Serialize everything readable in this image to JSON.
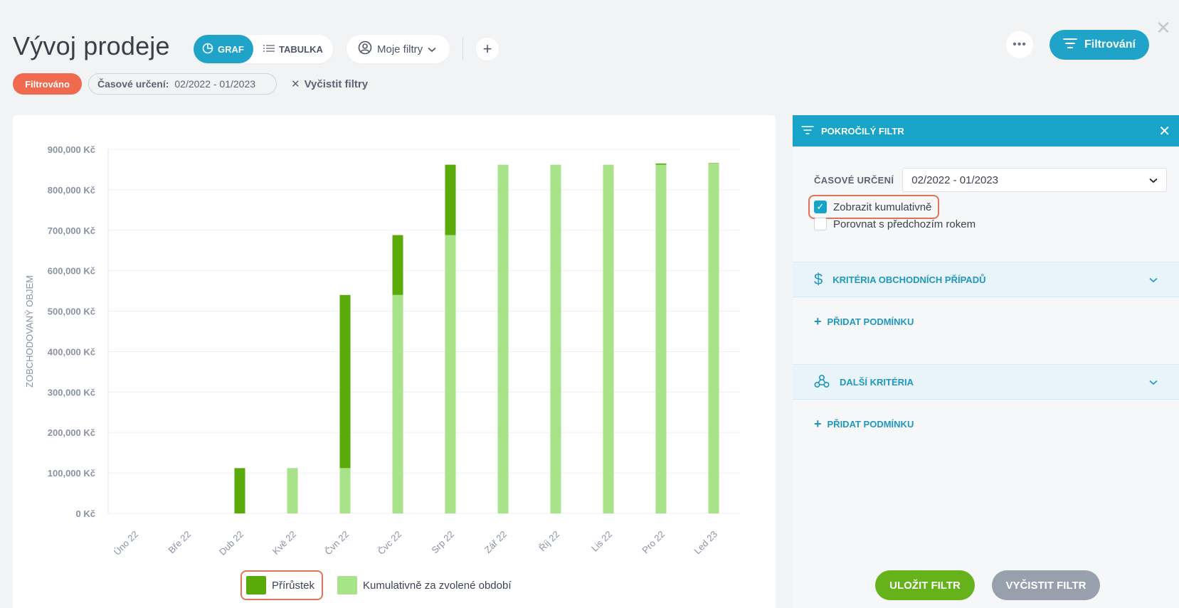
{
  "header": {
    "title": "Vývoj prodeje",
    "view_toggle": {
      "graf": "GRAF",
      "tabulka": "TABULKA"
    },
    "my_filters": "Moje filtry",
    "add": "+",
    "more": "•••",
    "filter_button": "Filtrování"
  },
  "chips": {
    "filtered": "Filtrováno",
    "time_label": "Časové určení:",
    "time_value": "02/2022 - 01/2023",
    "clear": "Vyčistit filtry"
  },
  "legend": {
    "increment": "Přírůstek",
    "cumulative": "Kumulativně za zvolené období"
  },
  "panel": {
    "title": "POKROČILÝ FILTR",
    "time_label": "ČASOVÉ URČENÍ",
    "time_value": "02/2022 - 01/2023",
    "checkbox_cumulative": "Zobrazit kumulativně",
    "checkbox_compare": "Porovnat s předchozím rokem",
    "section_business": "KRITÉRIA OBCHODNÍCH PŘÍPADŮ",
    "section_other": "DALŠÍ KRITÉRIA",
    "add_condition": "PŘIDAT PODMÍNKU",
    "save": "ULOŽIT FILTR",
    "clear": "VYČISTIT FILTR"
  },
  "colors": {
    "accent": "#1fa3c8",
    "increment": "#5aaa0a",
    "cumulative": "#a8e38a",
    "filtered_chip": "#ef6a4f",
    "save_button": "#66b21a",
    "clear_button": "#99a0ad"
  },
  "chart_data": {
    "type": "bar",
    "stacked": true,
    "ylabel": "ZOBCHODOVANÝ OBJEM",
    "xlabel": "",
    "ylim": [
      0,
      900000
    ],
    "yticks": [
      "0 Kč",
      "100,000 Kč",
      "200,000 Kč",
      "300,000 Kč",
      "400,000 Kč",
      "500,000 Kč",
      "600,000 Kč",
      "700,000 Kč",
      "800,000 Kč",
      "900,000 Kč"
    ],
    "categories": [
      "Úno 22",
      "Bře 22",
      "Dub 22",
      "Kvě 22",
      "Čvn 22",
      "Čvc 22",
      "Srp 22",
      "Zář 22",
      "Říj 22",
      "Lis 22",
      "Pro 22",
      "Led 23"
    ],
    "series": [
      {
        "name": "Kumulativně za zvolené období",
        "color": "#a8e38a",
        "values": [
          0,
          0,
          0,
          112000,
          112000,
          540000,
          688000,
          862000,
          862000,
          862000,
          862000,
          865000
        ]
      },
      {
        "name": "Přírůstek",
        "color": "#5aaa0a",
        "values": [
          0,
          0,
          112000,
          0,
          428000,
          148000,
          174000,
          0,
          0,
          0,
          3000,
          1000
        ]
      }
    ],
    "grid": true,
    "legend_position": "bottom"
  }
}
